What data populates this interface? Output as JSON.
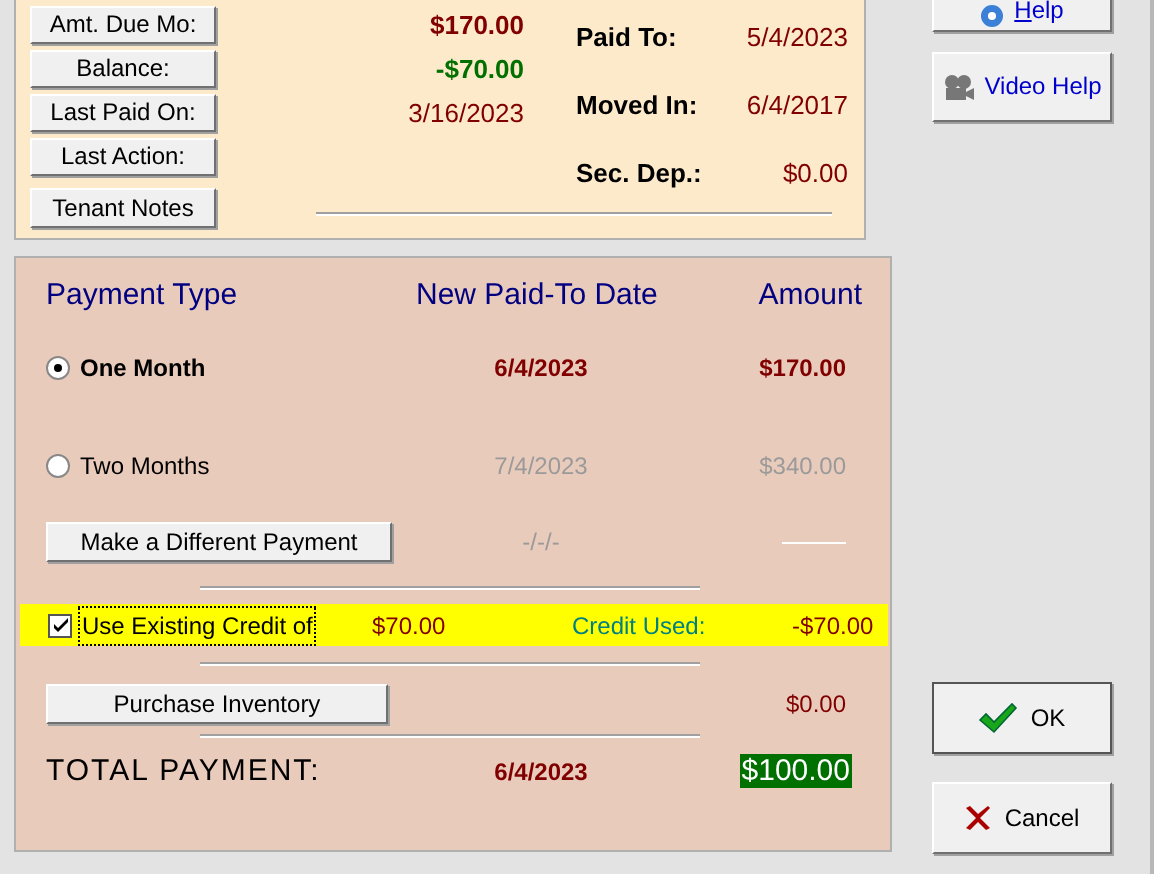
{
  "account": {
    "fields": [
      {
        "button": "Amt. Due Mo:",
        "value": "$170.00",
        "kind": "due"
      },
      {
        "button": "Balance:",
        "value": "-$70.00",
        "kind": "credit"
      },
      {
        "button": "Last Paid On:",
        "value": "3/16/2023",
        "kind": "date"
      },
      {
        "button": "Last Action:"
      }
    ],
    "notes_button": "Tenant Notes",
    "summary": [
      {
        "label": "Paid To:",
        "value": "5/4/2023"
      },
      {
        "label": "Moved In:",
        "value": "6/4/2017"
      },
      {
        "label": "Sec. Dep.:",
        "value": "$0.00"
      }
    ]
  },
  "payment": {
    "headers": [
      "Payment Type",
      "New Paid-To Date",
      "Amount"
    ],
    "options": [
      {
        "label": "One Month",
        "date": "6/4/2023",
        "amount": "$170.00",
        "selected": true
      },
      {
        "label": "Two Months",
        "date": "7/4/2023",
        "amount": "$340.00",
        "selected": false
      }
    ],
    "different": {
      "button": "Make a Different Payment",
      "date": "-/-/-"
    },
    "credit": {
      "checked": true,
      "label": "Use Existing Credit of",
      "amount": "$70.00",
      "used_label": "Credit Used:",
      "used": "-$70.00"
    },
    "inventory": {
      "button": "Purchase Inventory",
      "amount": "$0.00"
    },
    "total": {
      "label": "TOTAL PAYMENT:",
      "date": "6/4/2023",
      "amount": "$100.00"
    }
  },
  "side_buttons": [
    {
      "label": "Help",
      "kind": "help"
    },
    {
      "label": "Video Help",
      "kind": "video"
    }
  ],
  "ok_button": "OK",
  "cancel_button": "Cancel"
}
